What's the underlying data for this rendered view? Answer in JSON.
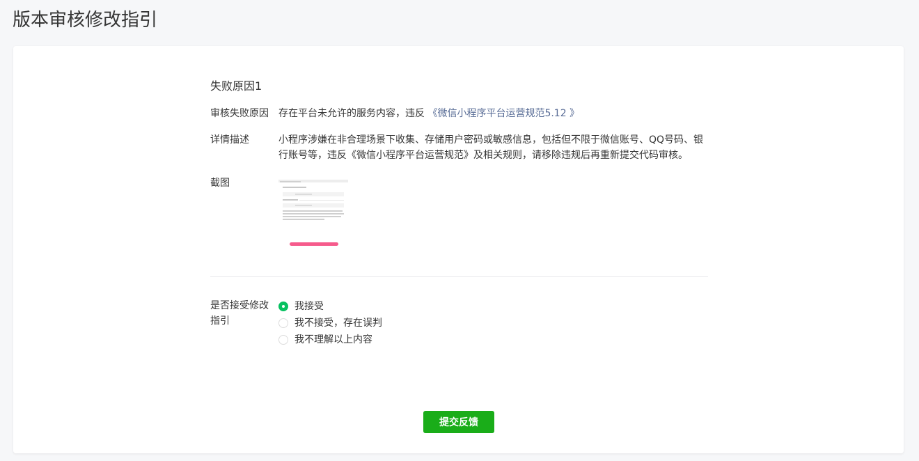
{
  "page": {
    "title": "版本审核修改指引"
  },
  "failure": {
    "section_title": "失败原因1",
    "reason_label": "审核失败原因",
    "reason_text": "存在平台未允许的服务内容，违反 ",
    "reason_link": "《微信小程序平台运营规范5.12 》",
    "detail_label": "详情描述",
    "detail_text": "小程序涉嫌在非合理场景下收集、存储用户密码或敏感信息，包括但不限于微信账号、QQ号码、银行账号等，违反《微信小程序平台运营规范》及相关规则，请移除违规后再重新提交代码审核。",
    "screenshot_label": "截图"
  },
  "accept": {
    "label": "是否接受修改指引",
    "options": [
      {
        "label": "我接受",
        "checked": true
      },
      {
        "label": "我不接受，存在误判",
        "checked": false
      },
      {
        "label": "我不理解以上内容",
        "checked": false
      }
    ]
  },
  "submit": {
    "label": "提交反馈"
  },
  "colors": {
    "primary_green": "#1aad19",
    "radio_green": "#07c160",
    "link_blue": "#576b95"
  }
}
